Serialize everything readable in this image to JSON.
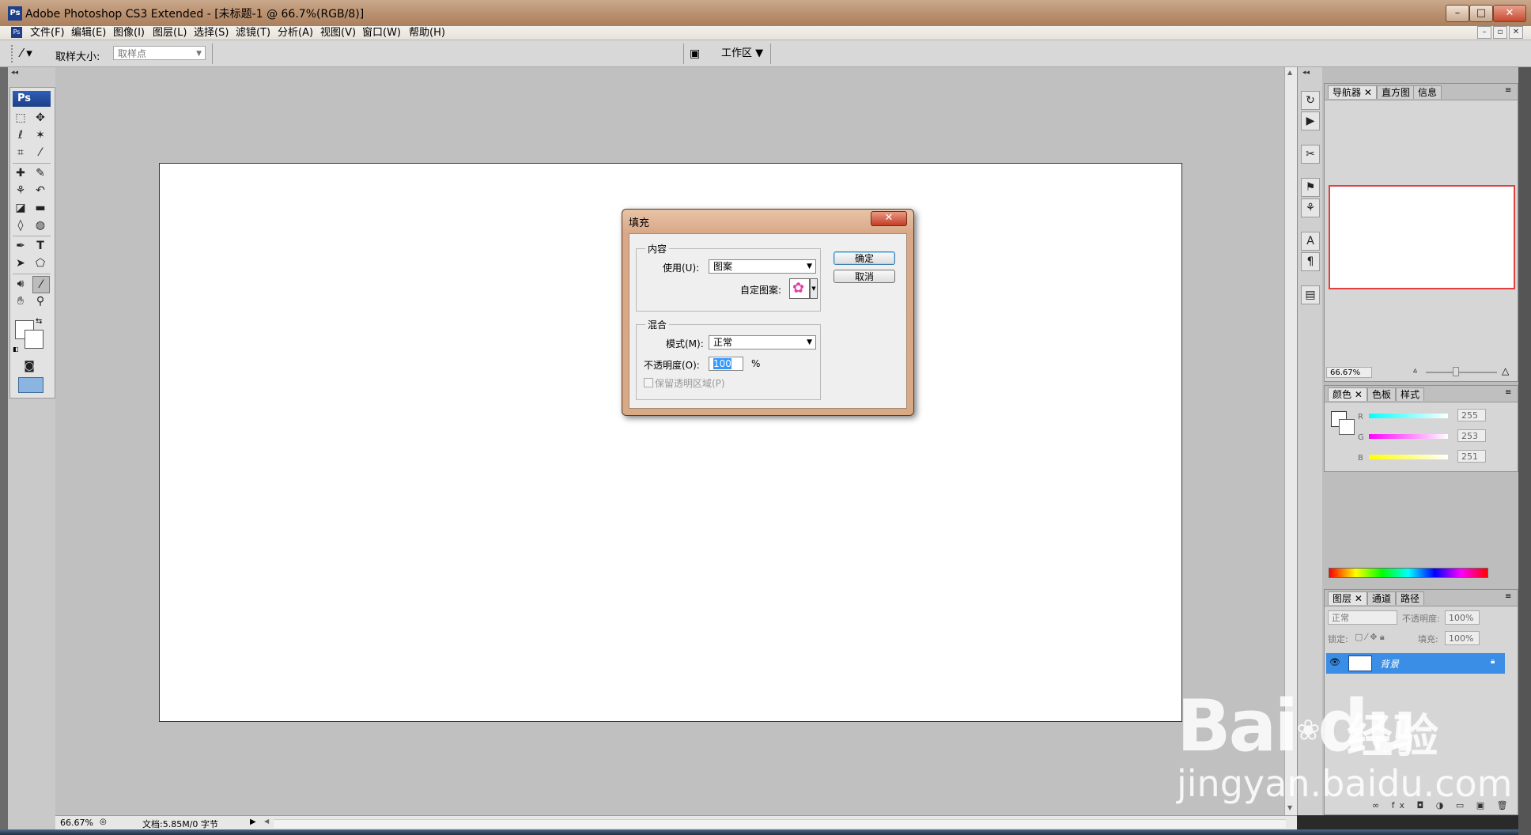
{
  "window": {
    "title": "Adobe Photoshop CS3 Extended - [未标题-1 @ 66.7%(RGB/8)]",
    "app_icon": "Ps",
    "controls": [
      "–",
      "□",
      "✕"
    ]
  },
  "menu": {
    "items": [
      "文件(F)",
      "编辑(E)",
      "图像(I)",
      "图层(L)",
      "选择(S)",
      "滤镜(T)",
      "分析(A)",
      "视图(V)",
      "窗口(W)",
      "帮助(H)"
    ],
    "doc_controls": [
      "–",
      "▫",
      "✕"
    ]
  },
  "options_bar": {
    "sample_size_label": "取样大小:",
    "sample_size_value": "取样点",
    "workspace_label": "工作区"
  },
  "toolbox": {
    "logo": "Ps"
  },
  "status": {
    "zoom": "66.67%",
    "doc_info": "文档:5.85M/0 字节"
  },
  "navigator_panel": {
    "tabs": [
      "导航器",
      "直方图",
      "信息"
    ],
    "zoom": "66.67%"
  },
  "color_panel": {
    "tabs": [
      "颜色",
      "色板",
      "样式"
    ],
    "channels": [
      {
        "label": "R",
        "value": "255"
      },
      {
        "label": "G",
        "value": "253"
      },
      {
        "label": "B",
        "value": "251"
      }
    ]
  },
  "layers_panel": {
    "tabs": [
      "图层",
      "通道",
      "路径"
    ],
    "blend_mode": "正常",
    "opacity_label": "不透明度:",
    "opacity_value": "100%",
    "lock_label": "锁定:",
    "fill_label": "填充:",
    "fill_value": "100%",
    "layers": [
      {
        "name": "背景",
        "selected": true
      }
    ]
  },
  "fill_dialog": {
    "title": "填充",
    "close": "✕",
    "content_group": "内容",
    "use_label": "使用(U):",
    "use_value": "图案",
    "custom_pattern_label": "自定图案:",
    "blend_group": "混合",
    "mode_label": "模式(M):",
    "mode_value": "正常",
    "opacity_label": "不透明度(O):",
    "opacity_value": "100",
    "percent": "%",
    "preserve_label": "保留透明区域(P)",
    "ok_label": "确定",
    "cancel_label": "取消"
  },
  "watermark": {
    "brand": "Bai",
    "brand_tail": "du",
    "chinese": "经验",
    "url": "jingyan.baidu.com"
  },
  "colors": {
    "title_bar": "#b88e6c",
    "workspace": "#c0c0c0",
    "layer_selected": "#3a8ee6",
    "navigator_frame": "#e04040"
  }
}
